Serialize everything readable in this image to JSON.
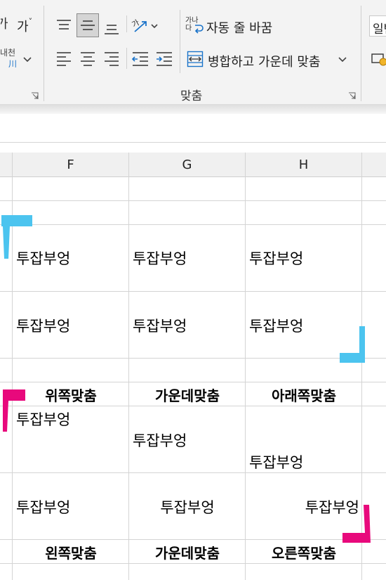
{
  "ribbon": {
    "font_group": {
      "size_increase_glyph": "가",
      "phonetic_label": "내천",
      "phonetic_sub": "川"
    },
    "alignment": {
      "orientation_label": "가",
      "wrap_text_label": "자동 줄 바꿈",
      "wrap_icon_top": "가나",
      "wrap_icon_bottom": "다",
      "merge_center_label": "병합하고 가운데 맞춤",
      "group_label": "맞춤"
    },
    "number": {
      "format_value": "일반"
    }
  },
  "columns": [
    "F",
    "G",
    "H"
  ],
  "rows": {
    "row1": {
      "F": "투잡부엉",
      "G": "투잡부엉",
      "H": "투잡부엉"
    },
    "row2": {
      "F": "투잡부엉",
      "G": "투잡부엉",
      "H": "투잡부엉"
    },
    "vertical_headers": {
      "F": "위쪽맞춤",
      "G": "가운데맞춤",
      "H": "아래쪽맞춤"
    },
    "row3": {
      "F": "투잡부엉",
      "G": "투잡부엉",
      "H": "투잡부엉"
    },
    "row4": {
      "F": "투잡부엉",
      "G": "투잡부엉",
      "H": "투잡부엉"
    },
    "horizontal_headers": {
      "F": "왼쪽맞춤",
      "G": "가운데맞춤",
      "H": "오른쪽맞춤"
    }
  },
  "colors": {
    "selected_button": "#d5d5d5",
    "cyan_marker": "#4cc4ef",
    "pink_marker": "#e8097c",
    "ribbon_bg": "#f3f3f3",
    "grid_line": "#d4d4d4"
  }
}
